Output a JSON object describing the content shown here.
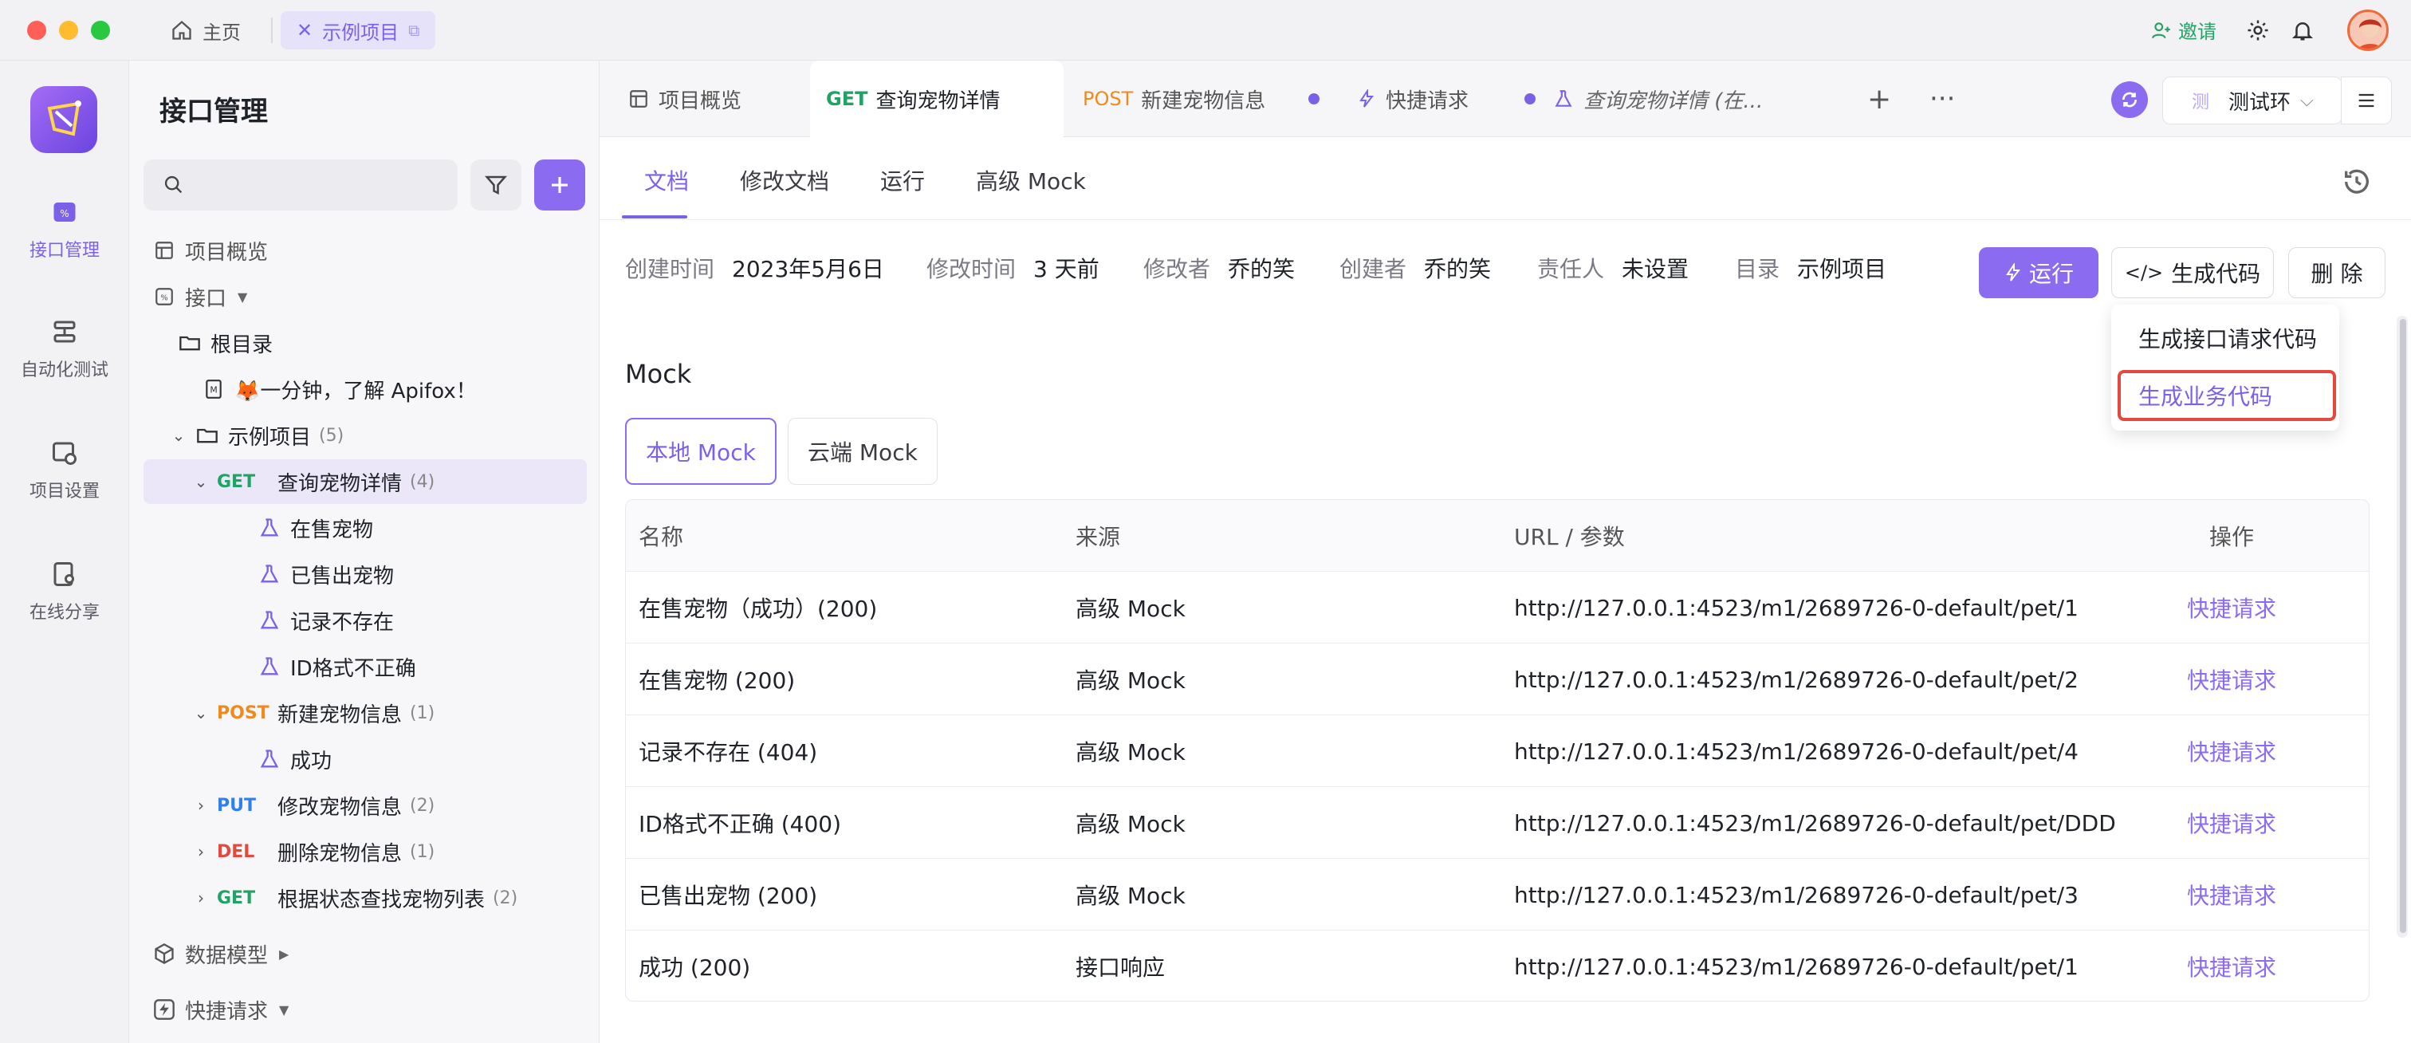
{
  "titlebar": {
    "home_label": "主页",
    "project_tab_label": "示例项目",
    "invite_label": "邀请"
  },
  "rail": {
    "items": [
      {
        "label": "接口管理",
        "icon": "api-icon",
        "active": true
      },
      {
        "label": "自动化测试",
        "icon": "automation-icon",
        "active": false
      },
      {
        "label": "项目设置",
        "icon": "project-settings-icon",
        "active": false
      },
      {
        "label": "在线分享",
        "icon": "share-icon",
        "active": false
      }
    ]
  },
  "sidebar": {
    "title": "接口管理",
    "search_placeholder": "",
    "tree": {
      "overview": "项目概览",
      "api": "接口",
      "root": "根目录",
      "doc": "🦊一分钟，了解 Apifox！",
      "folder": "示例项目",
      "folder_count": "(5)",
      "get_method": "GET",
      "get_name": "查询宠物详情",
      "get_count": "(4)",
      "case1": "在售宠物",
      "case2": "已售出宠物",
      "case3": "记录不存在",
      "case4": "ID格式不正确",
      "post_method": "POST",
      "post_name": "新建宠物信息",
      "post_count": "(1)",
      "post_case": "成功",
      "put_method": "PUT",
      "put_name": "修改宠物信息",
      "put_count": "(2)",
      "del_method": "DEL",
      "del_name": "删除宠物信息",
      "del_count": "(1)",
      "get2_method": "GET",
      "get2_name": "根据状态查找宠物列表",
      "get2_count": "(2)",
      "models": "数据模型",
      "quick": "快捷请求"
    }
  },
  "tabs": {
    "overview": "项目概览",
    "active_method": "GET",
    "active_name": "查询宠物详情",
    "post_method": "POST",
    "post_name": "新建宠物信息",
    "quick": "快捷请求",
    "italic": "查询宠物详情 (在..."
  },
  "env": {
    "badge": "测",
    "name": "测试环"
  },
  "subtabs": {
    "doc": "文档",
    "edit": "修改文档",
    "run": "运行",
    "mock": "高级 Mock"
  },
  "meta": {
    "created_k": "创建时间",
    "created_v": "2023年5月6日",
    "modified_k": "修改时间",
    "modified_v": "3 天前",
    "modifier_k": "修改者",
    "modifier_v": "乔的笑",
    "creator_k": "创建者",
    "creator_v": "乔的笑",
    "owner_k": "责任人",
    "owner_v": "未设置",
    "dir_k": "目录",
    "dir_v": "示例项目"
  },
  "actions": {
    "run": "运行",
    "gen": "生成代码",
    "del": "删 除"
  },
  "dropdown": {
    "item1": "生成接口请求代码",
    "item2": "生成业务代码"
  },
  "mock": {
    "title": "Mock",
    "local": "本地 Mock",
    "cloud": "云端 Mock",
    "headers": [
      "名称",
      "来源",
      "URL / 参数",
      "操作"
    ],
    "rows": [
      {
        "name": "在售宠物（成功）(200)",
        "source": "高级 Mock",
        "url": "http://127.0.0.1:4523/m1/2689726-0-default/pet/1",
        "action": "快捷请求"
      },
      {
        "name": "在售宠物 (200)",
        "source": "高级 Mock",
        "url": "http://127.0.0.1:4523/m1/2689726-0-default/pet/2",
        "action": "快捷请求"
      },
      {
        "name": "记录不存在 (404)",
        "source": "高级 Mock",
        "url": "http://127.0.0.1:4523/m1/2689726-0-default/pet/4",
        "action": "快捷请求"
      },
      {
        "name": "ID格式不正确 (400)",
        "source": "高级 Mock",
        "url": "http://127.0.0.1:4523/m1/2689726-0-default/pet/DDD",
        "action": "快捷请求"
      },
      {
        "name": "已售出宠物 (200)",
        "source": "高级 Mock",
        "url": "http://127.0.0.1:4523/m1/2689726-0-default/pet/3",
        "action": "快捷请求"
      },
      {
        "name": "成功 (200)",
        "source": "接口响应",
        "url": "http://127.0.0.1:4523/m1/2689726-0-default/pet/1",
        "action": "快捷请求"
      }
    ]
  },
  "colors": {
    "accent": "#7b61e8",
    "get": "#21a366",
    "post": "#ef8a1f",
    "put": "#2f7ff0",
    "del": "#e5483d"
  }
}
